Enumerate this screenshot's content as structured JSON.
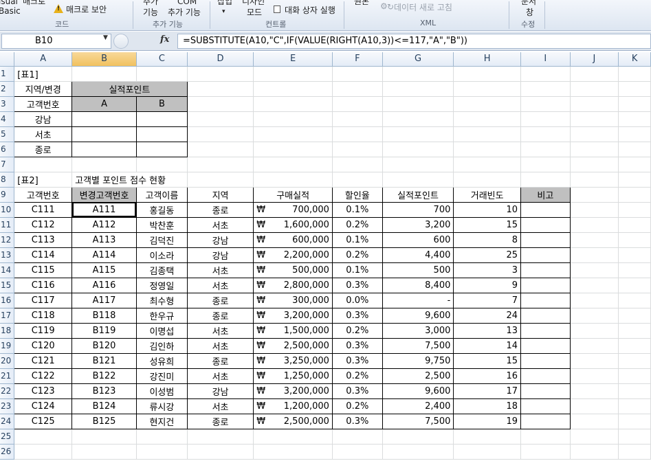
{
  "ribbon": {
    "groups": [
      {
        "label": "코드",
        "items": [
          "isual",
          "Basic",
          "매크로",
          "매크로 보안"
        ]
      },
      {
        "label": "추가 기능",
        "items": [
          "추가",
          "기능",
          "COM",
          "추가 기능"
        ]
      },
      {
        "label": "컨트롤",
        "items": [
          "삽입",
          "디자인",
          "모드",
          "대화 상자 실행"
        ]
      },
      {
        "label": "XML",
        "items": [
          "원본",
          "데이터 새로 고침"
        ]
      },
      {
        "label": "수정",
        "items": [
          "문서",
          "창"
        ]
      }
    ]
  },
  "formula_bar": {
    "name_box": "B10",
    "fx": "fx",
    "formula": "=SUBSTITUTE(A10,\"C\",IF(VALUE(RIGHT(A10,3))<=117,\"A\",\"B\"))"
  },
  "columns": [
    "A",
    "B",
    "C",
    "D",
    "E",
    "F",
    "G",
    "H",
    "I",
    "J",
    "K"
  ],
  "rows": [
    "1",
    "2",
    "3",
    "4",
    "5",
    "6",
    "7",
    "8",
    "9",
    "10",
    "11",
    "12",
    "13",
    "14",
    "15",
    "16",
    "17",
    "18",
    "19",
    "20",
    "21",
    "22",
    "23",
    "24",
    "25",
    "26"
  ],
  "table1": {
    "title": "[표1]",
    "header_row1": "지역/변경",
    "header_row2": "고객번호",
    "merged_header": "실적포인트",
    "col_a": "A",
    "col_b": "B",
    "regions": [
      "강남",
      "서초",
      "종로"
    ]
  },
  "table2": {
    "title": "[표2]",
    "subtitle": "고객별 포인트 점수 현황",
    "headers": [
      "고객번호",
      "변경고객번호",
      "고객이름",
      "지역",
      "구매실적",
      "할인율",
      "실적포인트",
      "거래빈도",
      "비고"
    ],
    "currency": "₩",
    "rows": [
      {
        "id": "C111",
        "new_id": "A111",
        "name": "홍길동",
        "region": "종로",
        "sales": "700,000",
        "rate": "0.1%",
        "points": "700",
        "freq": "10"
      },
      {
        "id": "C112",
        "new_id": "A112",
        "name": "박찬훈",
        "region": "서초",
        "sales": "1,600,000",
        "rate": "0.2%",
        "points": "3,200",
        "freq": "15"
      },
      {
        "id": "C113",
        "new_id": "A113",
        "name": "김덕진",
        "region": "강남",
        "sales": "600,000",
        "rate": "0.1%",
        "points": "600",
        "freq": "8"
      },
      {
        "id": "C114",
        "new_id": "A114",
        "name": "이소라",
        "region": "강남",
        "sales": "2,200,000",
        "rate": "0.2%",
        "points": "4,400",
        "freq": "25"
      },
      {
        "id": "C115",
        "new_id": "A115",
        "name": "김종택",
        "region": "서초",
        "sales": "500,000",
        "rate": "0.1%",
        "points": "500",
        "freq": "3"
      },
      {
        "id": "C116",
        "new_id": "A116",
        "name": "정영일",
        "region": "서초",
        "sales": "2,800,000",
        "rate": "0.3%",
        "points": "8,400",
        "freq": "9"
      },
      {
        "id": "C117",
        "new_id": "A117",
        "name": "최수형",
        "region": "종로",
        "sales": "300,000",
        "rate": "0.0%",
        "points": "-",
        "freq": "7"
      },
      {
        "id": "C118",
        "new_id": "B118",
        "name": "한우규",
        "region": "종로",
        "sales": "3,200,000",
        "rate": "0.3%",
        "points": "9,600",
        "freq": "24"
      },
      {
        "id": "C119",
        "new_id": "B119",
        "name": "이명섭",
        "region": "서초",
        "sales": "1,500,000",
        "rate": "0.2%",
        "points": "3,000",
        "freq": "13"
      },
      {
        "id": "C120",
        "new_id": "B120",
        "name": "김인하",
        "region": "서초",
        "sales": "2,500,000",
        "rate": "0.3%",
        "points": "7,500",
        "freq": "14"
      },
      {
        "id": "C121",
        "new_id": "B121",
        "name": "성유희",
        "region": "종로",
        "sales": "3,250,000",
        "rate": "0.3%",
        "points": "9,750",
        "freq": "15"
      },
      {
        "id": "C122",
        "new_id": "B122",
        "name": "강진미",
        "region": "서초",
        "sales": "1,250,000",
        "rate": "0.2%",
        "points": "2,500",
        "freq": "16"
      },
      {
        "id": "C123",
        "new_id": "B123",
        "name": "이성범",
        "region": "강남",
        "sales": "3,200,000",
        "rate": "0.3%",
        "points": "9,600",
        "freq": "17"
      },
      {
        "id": "C124",
        "new_id": "B124",
        "name": "류시강",
        "region": "서초",
        "sales": "1,200,000",
        "rate": "0.2%",
        "points": "2,400",
        "freq": "18"
      },
      {
        "id": "C125",
        "new_id": "B125",
        "name": "현지건",
        "region": "종로",
        "sales": "2,500,000",
        "rate": "0.3%",
        "points": "7,500",
        "freq": "19"
      }
    ]
  }
}
